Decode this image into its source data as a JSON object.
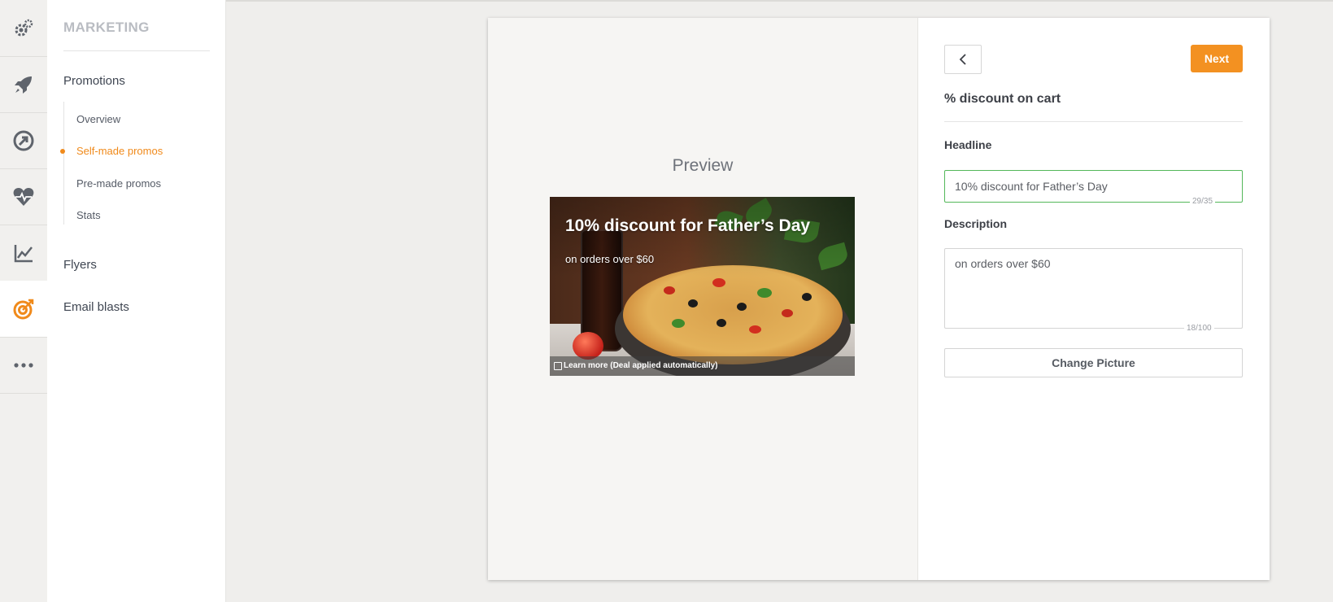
{
  "colors": {
    "accent": "#f08a1b",
    "next_button": "#f39121",
    "valid_border": "#54b85a"
  },
  "rail": {
    "items": [
      {
        "icon": "gears-icon",
        "active": false
      },
      {
        "icon": "rocket-icon",
        "active": false
      },
      {
        "icon": "compass-arrow-icon",
        "active": false
      },
      {
        "icon": "heart-pulse-icon",
        "active": false
      },
      {
        "icon": "line-chart-icon",
        "active": false
      },
      {
        "icon": "target-icon",
        "active": true
      },
      {
        "icon": "more-icon",
        "active": false
      }
    ]
  },
  "subnav": {
    "title": "MARKETING",
    "promotions": "Promotions",
    "items": [
      "Overview",
      "Self-made promos",
      "Pre-made promos",
      "Stats"
    ],
    "active_item": "Self-made promos",
    "flyers": "Flyers",
    "email_blasts": "Email blasts"
  },
  "preview": {
    "title": "Preview",
    "headline": "10% discount for Father’s Day",
    "description": "on orders over $60",
    "footer": "Learn more (Deal applied automatically)"
  },
  "editor": {
    "promo_type": "% discount on cart",
    "next_label": "Next",
    "headline_label": "Headline",
    "headline_value": "10% discount for Father’s Day",
    "headline_counter": "29/35",
    "description_label": "Description",
    "description_value": "on orders over $60",
    "description_counter": "18/100",
    "change_picture_label": "Change Picture"
  }
}
